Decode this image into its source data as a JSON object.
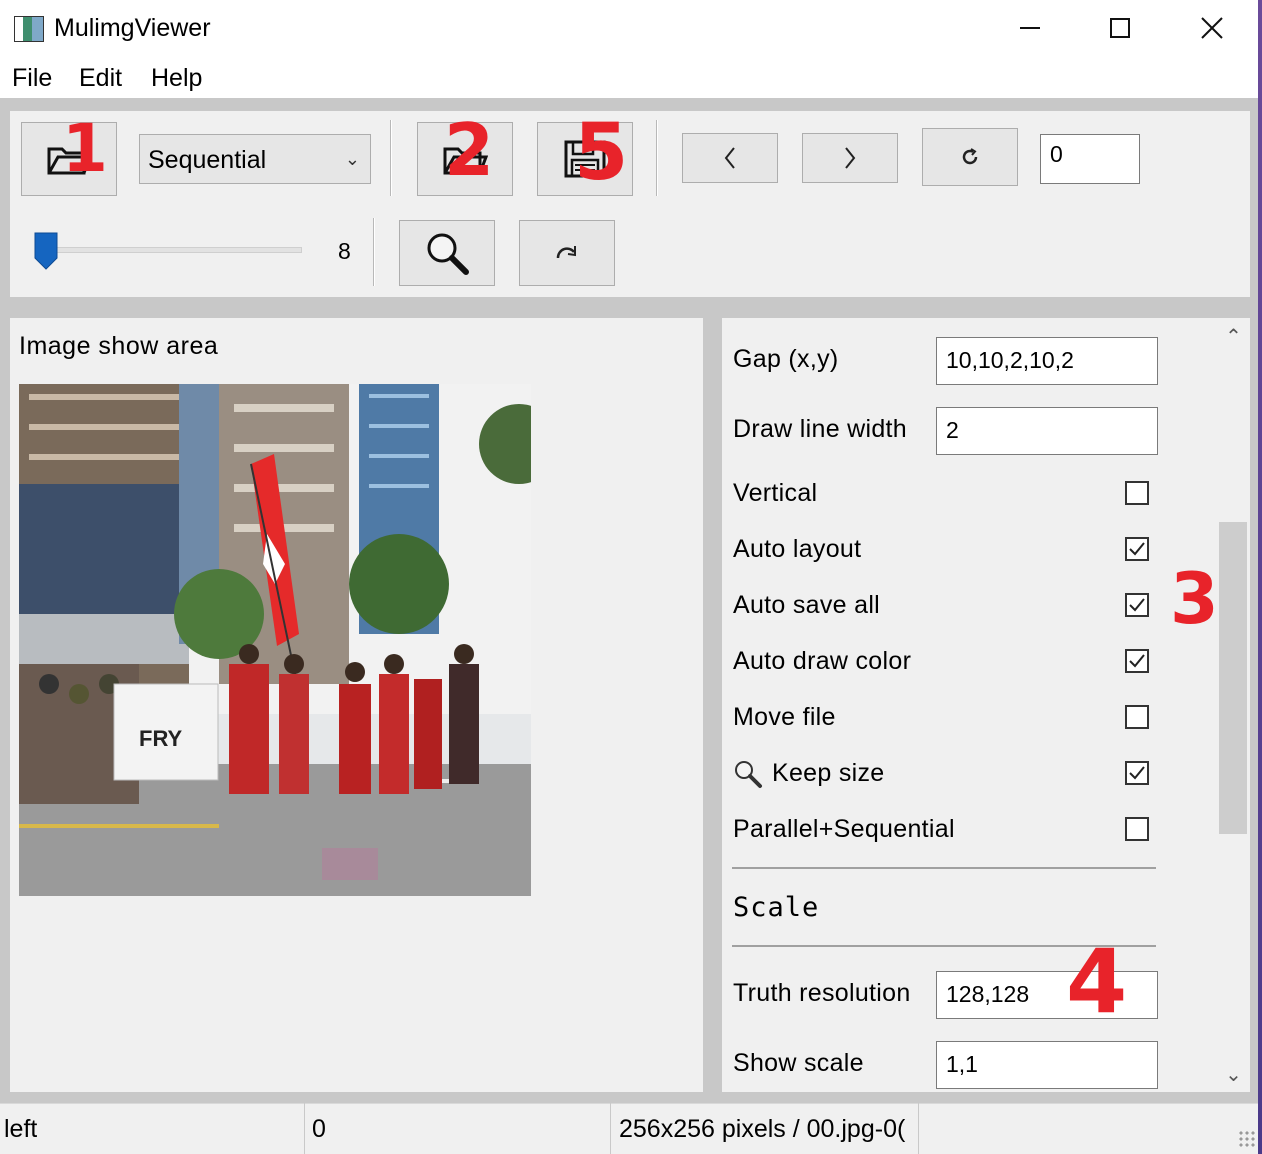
{
  "window": {
    "title": "MulimgViewer",
    "icon": "app-icon"
  },
  "menu": [
    "File",
    "Edit",
    "Help"
  ],
  "toolbar": {
    "mode_select": {
      "value": "Sequential"
    },
    "index_input": "0",
    "slider_value": "8",
    "icons": [
      "folder-open-icon",
      "folder-open-icon",
      "save-icon",
      "left-arrow-icon",
      "right-arrow-icon",
      "refresh-icon",
      "magnifier-icon",
      "redo-icon"
    ]
  },
  "image_area": {
    "label": "Image show area",
    "banner_text": "FRY"
  },
  "settings": {
    "gap": {
      "label": "Gap (x,y)",
      "value": "10,10,2,10,2"
    },
    "line_width": {
      "label": "Draw line width",
      "value": "2"
    },
    "checkboxes": [
      {
        "label": "Vertical",
        "checked": false
      },
      {
        "label": "Auto layout",
        "checked": true
      },
      {
        "label": "Auto save all",
        "checked": true
      },
      {
        "label": "Auto draw color",
        "checked": true
      },
      {
        "label": "Move file",
        "checked": false
      },
      {
        "label": "Keep size",
        "checked": true
      },
      {
        "label": "Parallel+Sequential",
        "checked": false
      }
    ],
    "scale_header": "Scale",
    "truth_resolution": {
      "label": "Truth resolution",
      "value": "128,128"
    },
    "show_scale": {
      "label": "Show scale",
      "value": "1,1"
    }
  },
  "status": {
    "left": "left",
    "middle": "0",
    "right": "256x256 pixels / 00.jpg-0("
  },
  "annotations": [
    "1",
    "2",
    "5",
    "3",
    "4"
  ],
  "colors": {
    "annotation": "#e8232a",
    "slider_handle": "#1565c0"
  }
}
